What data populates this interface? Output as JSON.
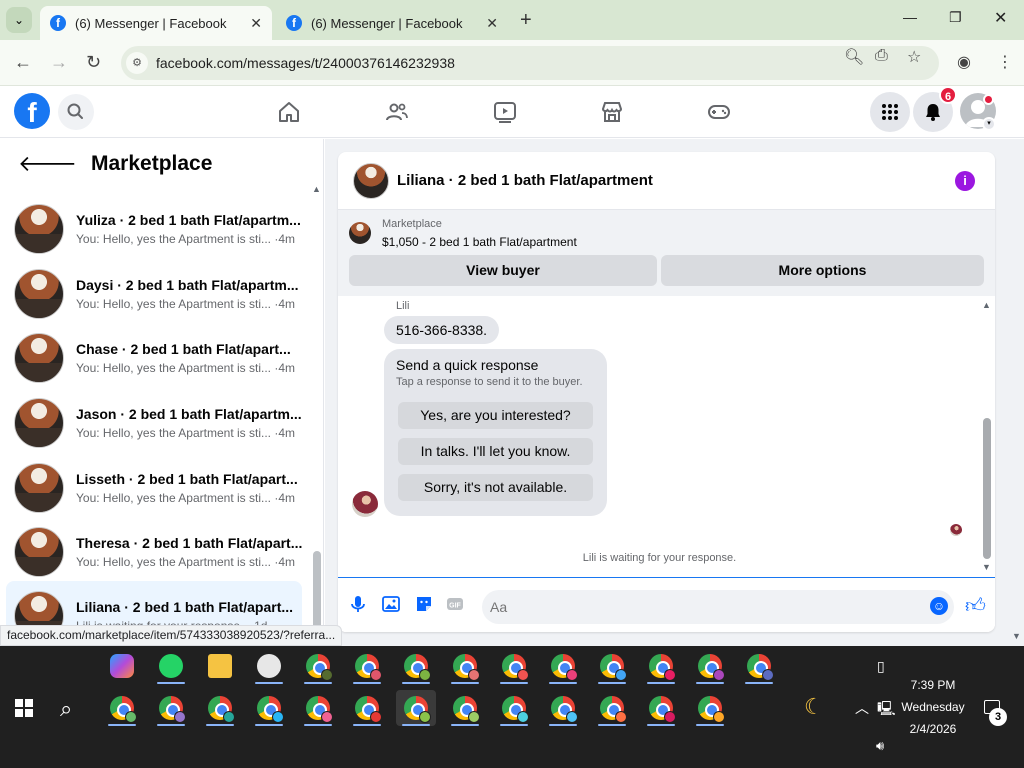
{
  "browser": {
    "tabs": [
      {
        "title": "(6) Messenger | Facebook",
        "active": true
      },
      {
        "title": "(6) Messenger | Facebook",
        "active": false
      }
    ],
    "url": "facebook.com/messages/t/24000376146232938",
    "status_url": "facebook.com/marketplace/item/574333038920523/?referra..."
  },
  "fb_header": {
    "notification_count": "6"
  },
  "sidebar": {
    "title": "Marketplace",
    "conversations": [
      {
        "name": "Yuliza · 2 bed 1 bath Flat/apartm...",
        "snippet": "You: Hello, yes the Apartment is sti... ·4m"
      },
      {
        "name": "Daysi · 2 bed 1 bath Flat/apartm...",
        "snippet": "You: Hello, yes the Apartment is sti... ·4m"
      },
      {
        "name": "Chase · 2 bed 1 bath Flat/apart...",
        "snippet": "You: Hello, yes the Apartment is sti... ·4m"
      },
      {
        "name": "Jason · 2 bed 1 bath Flat/apartm...",
        "snippet": "You: Hello, yes the Apartment is sti... ·4m"
      },
      {
        "name": "Lisseth · 2 bed 1 bath Flat/apart...",
        "snippet": "You: Hello, yes the Apartment is sti... ·4m"
      },
      {
        "name": "Theresa · 2 bed 1 bath Flat/apart...",
        "snippet": "You: Hello, yes the Apartment is sti... ·4m"
      },
      {
        "name": "Liliana · 2 bed 1 bath Flat/apart...",
        "snippet": "Lili is waiting for your response. · 1d"
      }
    ]
  },
  "chat": {
    "title": "Liliana · 2 bed 1 bath Flat/apartment",
    "marketplace_label": "Marketplace",
    "listing": "$1,050 - 2 bed 1 bath Flat/apartment",
    "view_buyer": "View buyer",
    "more_options": "More options",
    "sender": "Lili",
    "phone_message": "516-366-8338.",
    "quick_title": "Send a quick response",
    "quick_sub": "Tap a response to send it to the buyer.",
    "quick_options": [
      "Yes, are you interested?",
      "In talks. I'll let you know.",
      "Sorry, it's not available."
    ],
    "waiting": "Lili is waiting for your response.",
    "composer_placeholder": "Aa"
  },
  "taskbar": {
    "time": "7:39 PM",
    "day": "Wednesday",
    "date": "2/4/2026",
    "notification_count": "3"
  }
}
